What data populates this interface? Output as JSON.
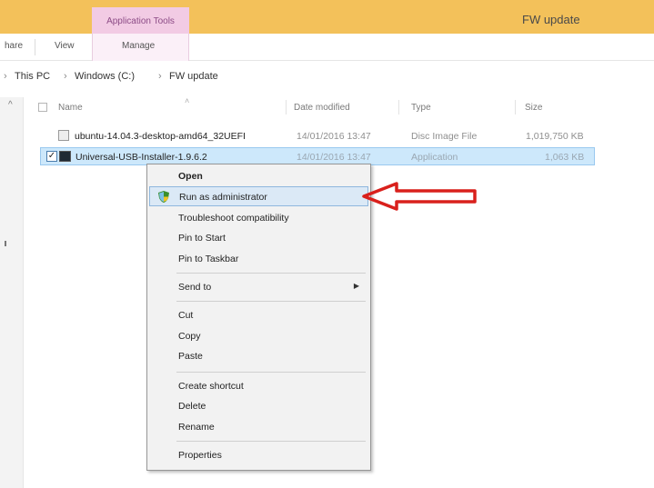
{
  "titlebar": {
    "context_tab": "Application Tools",
    "window_title": "FW update",
    "color": "#f3c15a"
  },
  "ribbon": {
    "tabs": [
      "hare",
      "View",
      "Manage"
    ]
  },
  "address": {
    "crumbs": [
      "This PC",
      "Windows (C:)",
      "FW update"
    ]
  },
  "columns": {
    "name": "Name",
    "date": "Date modified",
    "type": "Type",
    "size": "Size"
  },
  "files": [
    {
      "name": "ubuntu-14.04.3-desktop-amd64_32UEFI",
      "date": "14/01/2016 13:47",
      "type": "Disc Image File",
      "size": "1,019,750 KB"
    },
    {
      "name": "Universal-USB-Installer-1.9.6.2",
      "date": "14/01/2016 13:47",
      "type": "Application",
      "size": "1,063 KB",
      "selected": true
    }
  ],
  "context_menu": {
    "open": "Open",
    "run_as_admin": "Run as administrator",
    "troubleshoot": "Troubleshoot compatibility",
    "pin_start": "Pin to Start",
    "pin_taskbar": "Pin to Taskbar",
    "send_to": "Send to",
    "cut": "Cut",
    "copy": "Copy",
    "paste": "Paste",
    "create_shortcut": "Create shortcut",
    "delete": "Delete",
    "rename": "Rename",
    "properties": "Properties"
  },
  "annotation": {
    "arrow_color": "#d9201c"
  }
}
